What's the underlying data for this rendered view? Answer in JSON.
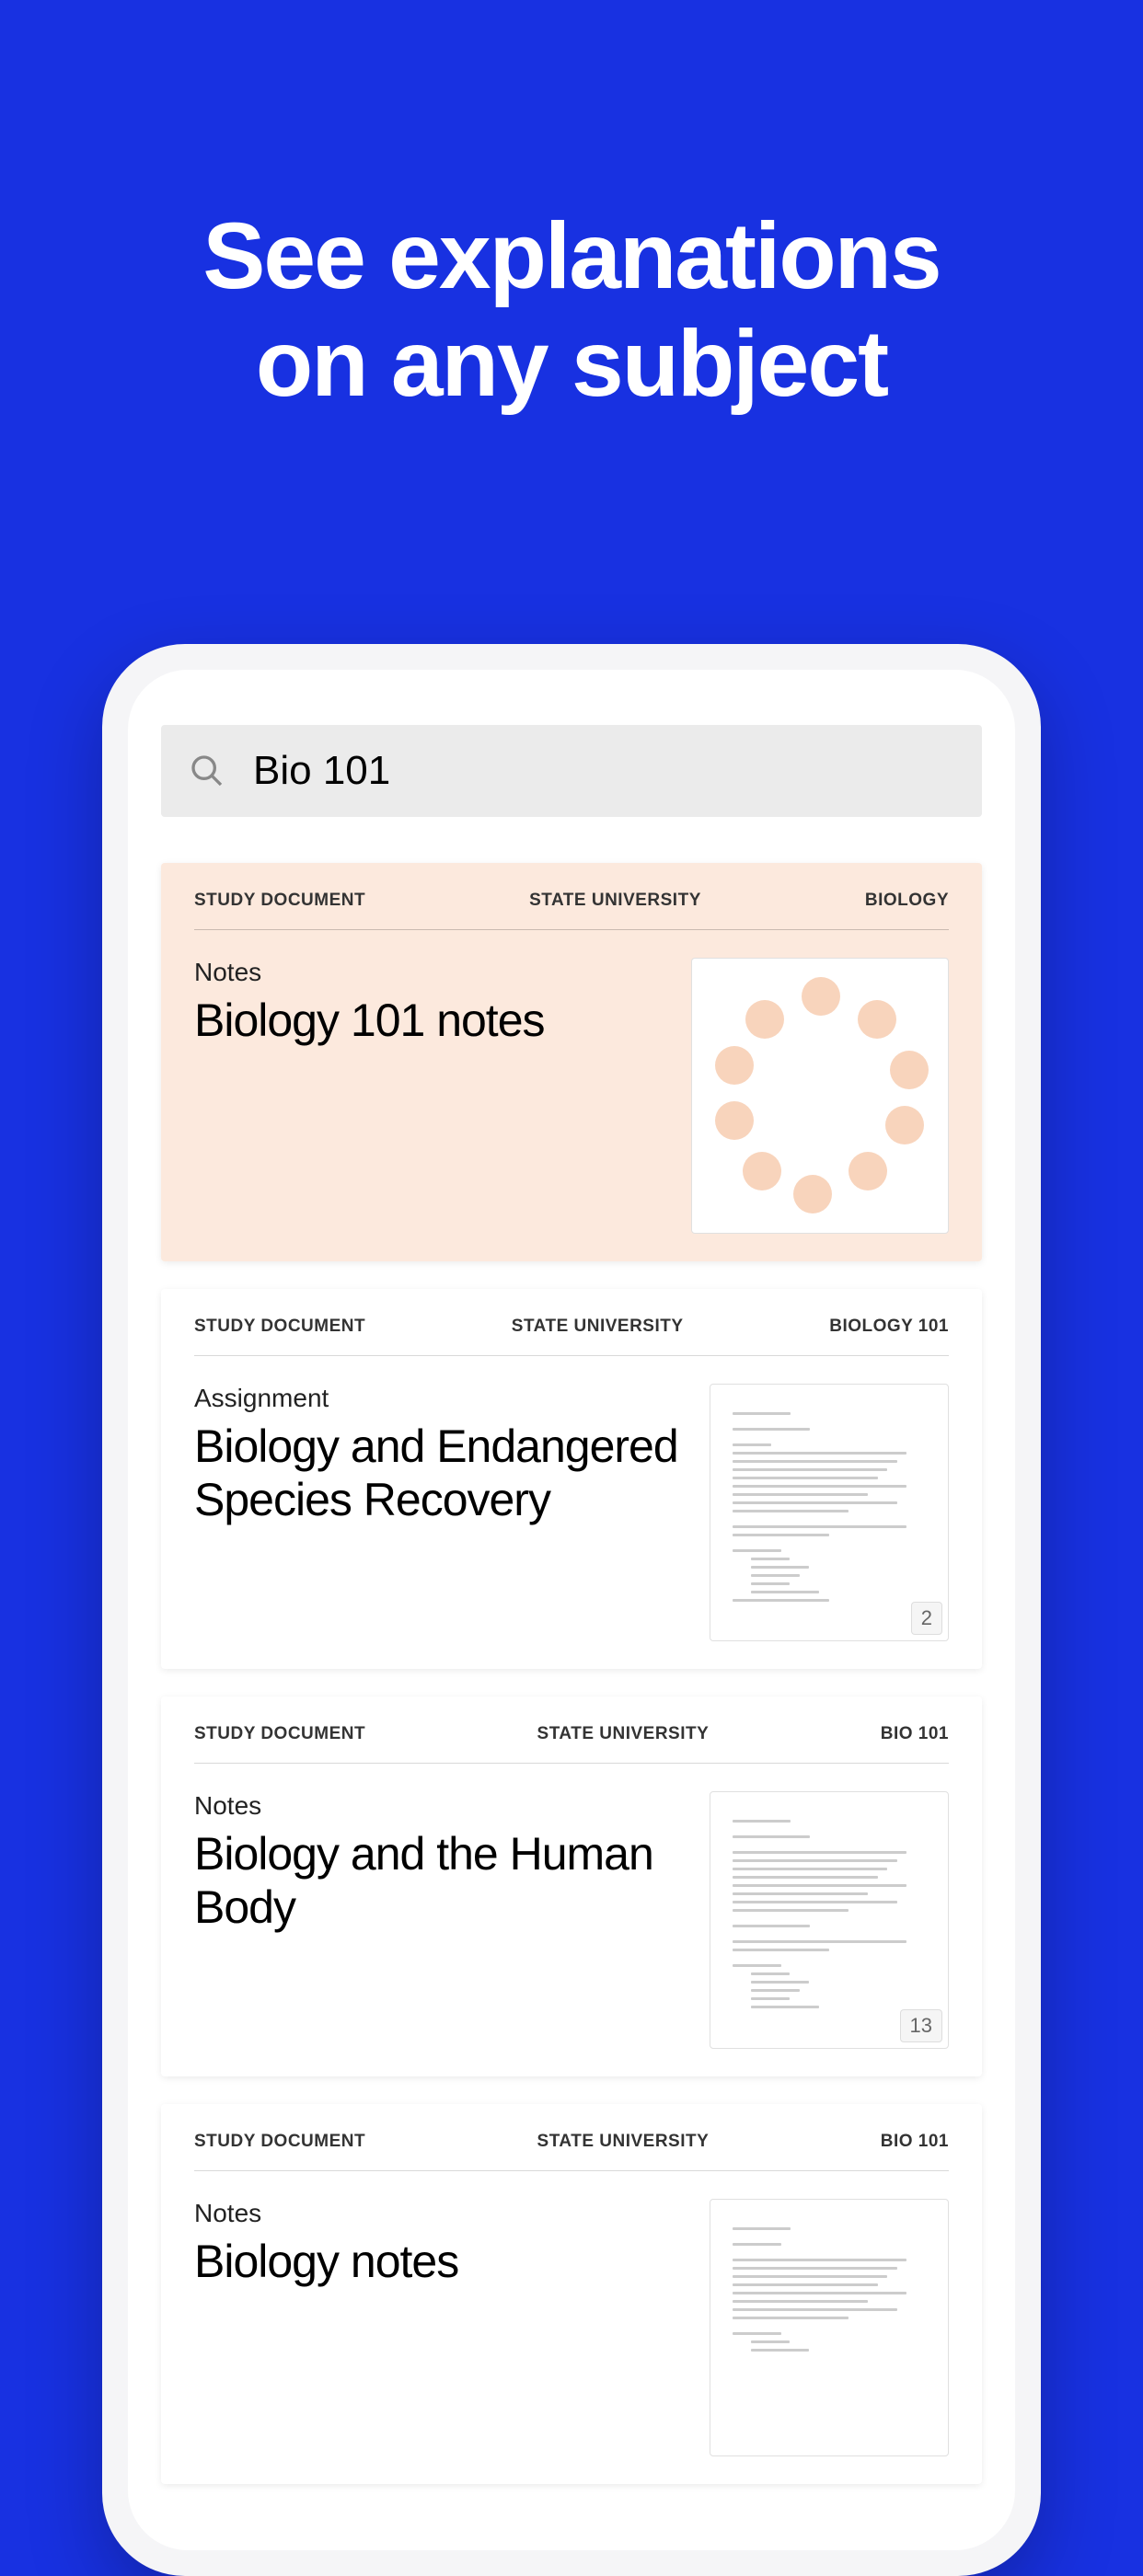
{
  "hero": {
    "line1": "See explanations",
    "line2": "on any subject"
  },
  "search": {
    "query": "Bio 101"
  },
  "cards": [
    {
      "docLabel": "STUDY DOCUMENT",
      "university": "STATE UNIVERSITY",
      "subject": "BIOLOGY",
      "type": "Notes",
      "title": "Biology 101 notes",
      "featured": true,
      "thumbStyle": "diagram"
    },
    {
      "docLabel": "STUDY DOCUMENT",
      "university": "STATE UNIVERSITY",
      "subject": "BIOLOGY 101",
      "type": "Assignment",
      "title": "Biology and Endangered Species Recovery",
      "pageCount": "2",
      "thumbStyle": "document"
    },
    {
      "docLabel": "STUDY DOCUMENT",
      "university": "STATE UNIVERSITY",
      "subject": "BIO 101",
      "type": "Notes",
      "title": "Biology and the Human Body",
      "pageCount": "13",
      "thumbStyle": "document"
    },
    {
      "docLabel": "STUDY DOCUMENT",
      "university": "STATE UNIVERSITY",
      "subject": "BIO 101",
      "type": "Notes",
      "title": "Biology notes",
      "thumbStyle": "document"
    }
  ]
}
